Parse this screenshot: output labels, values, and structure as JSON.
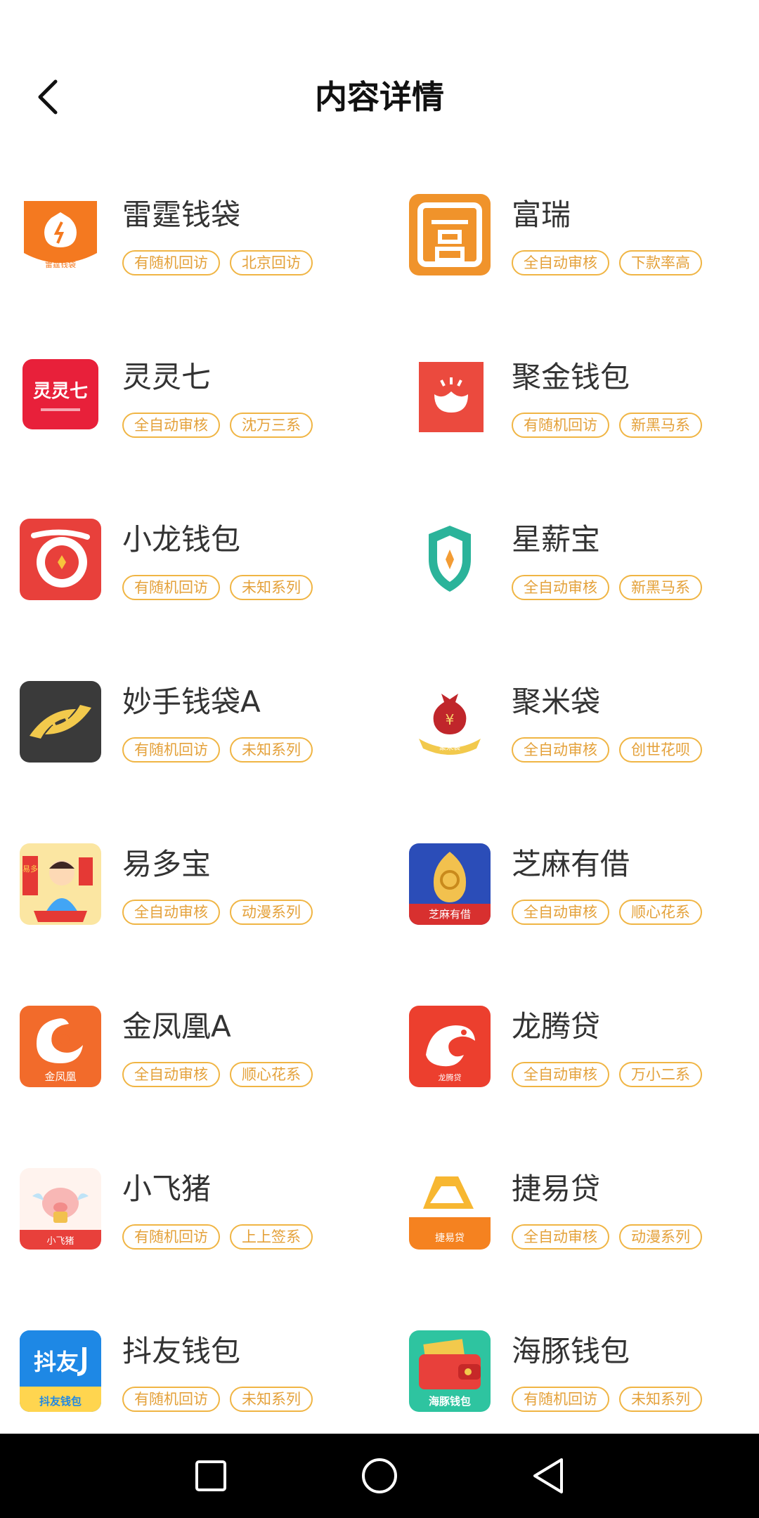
{
  "header": {
    "title": "内容详情"
  },
  "colors": {
    "tag_border": "#F0B544",
    "tag_text": "#E4A13A",
    "accent": "#F6821F",
    "nav_bg": "#000000"
  },
  "apps": [
    {
      "name": "雷霆钱袋",
      "tags": [
        "有随机回访",
        "北京回访"
      ],
      "icon": "money-bag-icon",
      "icon_text": "雷霆钱袋"
    },
    {
      "name": "富瑞",
      "tags": [
        "全自动审核",
        "下款率高"
      ],
      "icon": "fu-character-icon",
      "icon_text": ""
    },
    {
      "name": "灵灵七",
      "tags": [
        "全自动审核",
        "沈万三系"
      ],
      "icon": "lingling7-icon",
      "icon_text": "灵灵七"
    },
    {
      "name": "聚金钱包",
      "tags": [
        "有随机回访",
        "新黑马系"
      ],
      "icon": "lotus-icon",
      "icon_text": ""
    },
    {
      "name": "小龙钱包",
      "tags": [
        "有随机回访",
        "未知系列"
      ],
      "icon": "dragon-coin-icon",
      "icon_text": ""
    },
    {
      "name": "星薪宝",
      "tags": [
        "全自动审核",
        "新黑马系"
      ],
      "icon": "shield-icon",
      "icon_text": ""
    },
    {
      "name": "妙手钱袋A",
      "tags": [
        "有随机回访",
        "未知系列"
      ],
      "icon": "hand-coin-icon",
      "icon_text": ""
    },
    {
      "name": "聚米袋",
      "tags": [
        "全自动审核",
        "创世花呗"
      ],
      "icon": "yen-bag-icon",
      "icon_text": "聚米袋"
    },
    {
      "name": "易多宝",
      "tags": [
        "全自动审核",
        "动漫系列"
      ],
      "icon": "cartoon-girl-icon",
      "icon_text": "易多宝"
    },
    {
      "name": "芝麻有借",
      "tags": [
        "全自动审核",
        "顺心花系"
      ],
      "icon": "sesame-seed-icon",
      "icon_text": "芝麻有借"
    },
    {
      "name": "金凤凰A",
      "tags": [
        "全自动审核",
        "顺心花系"
      ],
      "icon": "phoenix-icon",
      "icon_text": "金凤凰"
    },
    {
      "name": "龙腾贷",
      "tags": [
        "全自动审核",
        "万小二系"
      ],
      "icon": "dragon-icon",
      "icon_text": "龙腾贷"
    },
    {
      "name": "小飞猪",
      "tags": [
        "有随机回访",
        "上上签系"
      ],
      "icon": "flying-pig-icon",
      "icon_text": "小飞猪"
    },
    {
      "name": "捷易贷",
      "tags": [
        "全自动审核",
        "动漫系列"
      ],
      "icon": "triangle-logo-icon",
      "icon_text": "捷易贷"
    },
    {
      "name": "抖友钱包",
      "tags": [
        "有随机回访",
        "未知系列"
      ],
      "icon": "douyou-icon",
      "icon_text": "抖友钱包"
    },
    {
      "name": "海豚钱包",
      "tags": [
        "有随机回访",
        "未知系列"
      ],
      "icon": "wallet-icon",
      "icon_text": "海豚钱包"
    }
  ],
  "nav": {
    "items": [
      "recent-apps-button",
      "home-button",
      "back-nav-button"
    ]
  }
}
